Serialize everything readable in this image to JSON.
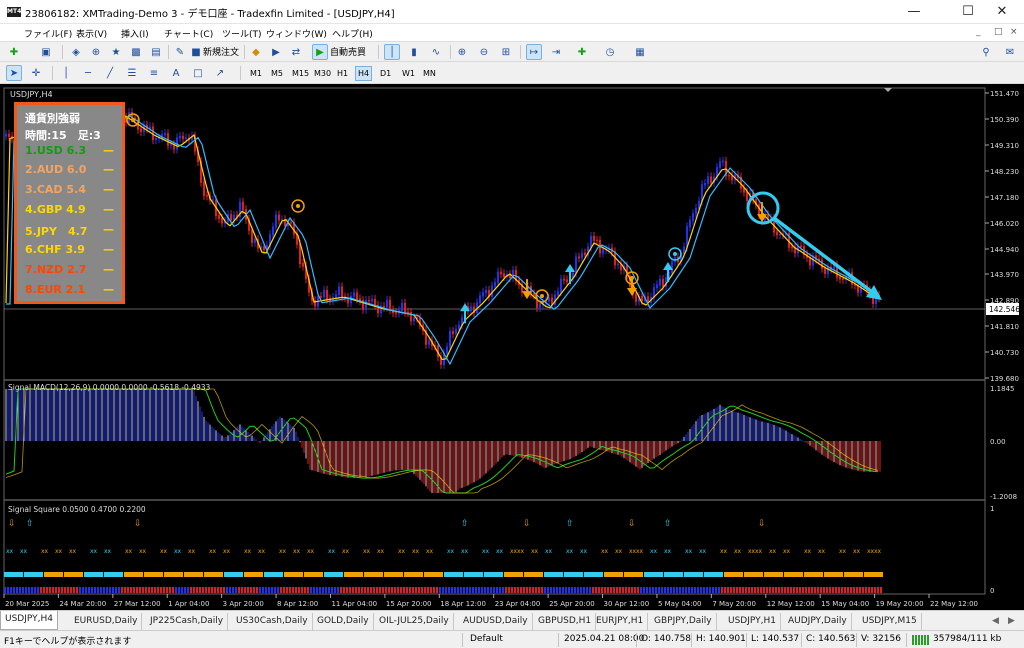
{
  "window": {
    "title": "23806182: XMTrading-Demo 3 - デモ口座 - Tradexfin Limited - [USDJPY,H4]",
    "icon": "MT4"
  },
  "menu": [
    "ファイル(F)",
    "表示(V)",
    "挿入(I)",
    "チャート(C)",
    "ツール(T)",
    "ウィンドウ(W)",
    "ヘルプ(H)"
  ],
  "toolbar": {
    "new_order": "新規注文",
    "auto_trading": "自動売買"
  },
  "timeframes": [
    "M1",
    "M5",
    "M15",
    "M30",
    "H1",
    "H4",
    "D1",
    "W1",
    "MN"
  ],
  "active_timeframe": "H4",
  "chart": {
    "symbol_label": "USDJPY,H4",
    "current_price": "142.546",
    "price_ticks": [
      "151.470",
      "150.390",
      "149.310",
      "148.230",
      "147.180",
      "146.020",
      "144.940",
      "143.970",
      "142.890",
      "141.810",
      "140.730",
      "139.680"
    ],
    "macd_label": "Signal MACD(12,26,9) 0.0000 0.0000 -0.5618 -0.4933",
    "macd_ticks": [
      "1.1845",
      "0.00",
      "-1.2008"
    ],
    "square_label": "Signal Square 0.0500 0.4700 0.2200",
    "square_ticks": [
      "1",
      "0"
    ],
    "time_labels": [
      "20 Mar 2025",
      "24 Mar 20:00",
      "27 Mar 12:00",
      "1 Apr 04:00",
      "3 Apr 20:00",
      "8 Apr 12:00",
      "11 Apr 04:00",
      "15 Apr 20:00",
      "18 Apr 12:00",
      "23 Apr 04:00",
      "25 Apr 20:00",
      "30 Apr 12:00",
      "5 May 04:00",
      "7 May 20:00",
      "12 May 12:00",
      "15 May 04:00",
      "19 May 20:00",
      "22 May 12:00"
    ],
    "colors": {
      "bull": "#2233ee",
      "bear": "#e02020",
      "fast_ma": "#ffd700",
      "slow_ma": "#33bbff",
      "signal_up": "#33ccee",
      "signal_down": "#f0a000"
    }
  },
  "strength": {
    "title": "通貨別強弱",
    "subtitle": "時間:15　足:3",
    "items": [
      {
        "label": "1.USD 6.3",
        "color": "#0f9d0f"
      },
      {
        "label": "2.AUD 6.0",
        "color": "#f4a460"
      },
      {
        "label": "3.CAD 5.4",
        "color": "#f4a460"
      },
      {
        "label": "4.GBP 4.9",
        "color": "#ffd700"
      },
      {
        "label": "5.JPY　4.7",
        "color": "#ffd700"
      },
      {
        "label": "6.CHF 3.9",
        "color": "#ffd700"
      },
      {
        "label": "7.NZD 2.7",
        "color": "#ff4500"
      },
      {
        "label": "8.EUR 2.1",
        "color": "#ff4500"
      }
    ]
  },
  "tabs": [
    "USDJPY,H4",
    "EURUSD,Daily",
    "JP225Cash,Daily",
    "US30Cash,Daily",
    "GOLD,Daily",
    "OIL-JUL25,Daily",
    "AUDUSD,Daily",
    "GBPUSD,H1",
    "EURJPY,H1",
    "GBPJPY,Daily",
    "USDJPY,H1",
    "AUDJPY,Daily",
    "USDJPY,M15"
  ],
  "status": {
    "help": "F1キーでヘルプが表示されます",
    "profile": "Default",
    "datetime": "2025.04.21 08:00",
    "open": "O: 140.758",
    "high": "H: 140.901",
    "low": "L: 140.537",
    "close": "C: 140.563",
    "volume": "V: 32156",
    "traffic": "357984/111 kb"
  }
}
